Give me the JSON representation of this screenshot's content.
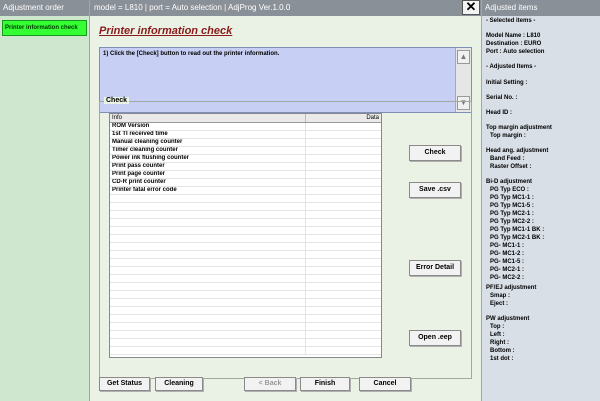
{
  "left_panel": {
    "title": "Adjustment order",
    "items": [
      {
        "label": "Printer information check",
        "selected": true
      }
    ]
  },
  "title_bar": {
    "text": "model = L810 | port = Auto selection | AdjProg Ver.1.0.0",
    "close_glyph": "✕"
  },
  "main": {
    "page_title": "Printer information check",
    "instruction": "1) Click the [Check] button to read out the printer information.",
    "check_group_label": "Check",
    "table": {
      "columns": [
        "Info",
        "Data"
      ],
      "rows": [
        {
          "info": "ROM Version",
          "data": ""
        },
        {
          "info": "1st TI received time",
          "data": ""
        },
        {
          "info": "Manual cleaning counter",
          "data": ""
        },
        {
          "info": "Timer cleaning counter",
          "data": ""
        },
        {
          "info": "Power ink flushing counter",
          "data": ""
        },
        {
          "info": "Print pass counter",
          "data": ""
        },
        {
          "info": "Print page counter",
          "data": ""
        },
        {
          "info": "CD-R print counter",
          "data": ""
        },
        {
          "info": "Printer fatal error code",
          "data": ""
        }
      ],
      "empty_rows": 20
    },
    "side_buttons": {
      "check": "Check",
      "save_csv": "Save .csv",
      "error_detail": "Error Detail",
      "open_eep": "Open .eep"
    },
    "bottom_buttons": {
      "get_status": "Get Status",
      "cleaning": "Cleaning",
      "back": "< Back",
      "finish": "Finish",
      "cancel": "Cancel"
    },
    "icons": {
      "scroll_up": "▲",
      "scroll_down": "▼"
    }
  },
  "right_panel": {
    "title": "Adjusted items",
    "selected_items_header": "- Selected items -",
    "model_name": "Model Name : L810",
    "destination": "Destination : EURO",
    "port": "Port : Auto selection",
    "adjusted_items_header": "- Adjusted Items -",
    "initial_setting": "Initial Setting :",
    "serial_no": "Serial No. :",
    "head_id": "Head ID :",
    "top_margin_adjustment": "Top margin adjustment",
    "top_margin": "Top margin :",
    "head_ang_adjustment": "Head ang. adjustment",
    "band_feed": "Band Feed :",
    "raster_offset": "Raster Offset :",
    "bid_adjustment": "Bi-D adjustment",
    "bid_items": [
      "PG Typ ECO :",
      "PG Typ MC1-1 :",
      "PG Typ MC1-5 :",
      "PG Typ MC2-1 :",
      "PG Typ MC2-2 :",
      "PG Typ MC1-1 BK :",
      "PG Typ MC2-1 BK :",
      "PG- MC1-1 :",
      "PG- MC1-2 :",
      "PG- MC1-5 :",
      "PG- MC2-1 :",
      "PG- MC2-2 :"
    ],
    "pfej_adjustment": "PF/EJ adjustment",
    "smap": "Smap :",
    "eject": "Eject :",
    "pw_adjustment": "PW adjustment",
    "pw_items": [
      "Top :",
      "Left :",
      "Right :",
      "Bottom :",
      "1st dot :"
    ]
  },
  "colors": {
    "title_bar_bg": "#8a9098",
    "selected_item_bg": "#33ff33",
    "page_title": "#8b1a1a",
    "instruction_bg": "#c7d0f4",
    "main_bg": "#e9f2e4",
    "right_panel_bg": "#d8dfe7"
  }
}
